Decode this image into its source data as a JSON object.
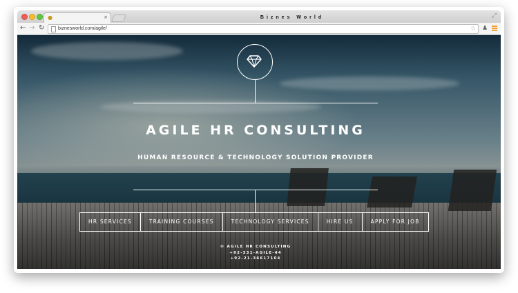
{
  "browser": {
    "tab_title": "Biznes World",
    "tab_close": "×",
    "url": "biznesworld.com/agile/",
    "back_glyph": "←",
    "forward_glyph": "→",
    "reload_glyph": "↻",
    "star_glyph": "☆",
    "extension_glyph": "♟",
    "expand_glyph": "⤢",
    "favicon_glyph": "●",
    "icons": [
      "back-icon",
      "forward-icon",
      "reload-icon",
      "page-icon",
      "star-icon",
      "extension-icon",
      "menu-icon",
      "expand-icon"
    ]
  },
  "hero": {
    "icon": "diamond-icon",
    "title": "AGILE HR CONSULTING",
    "subtitle": "HUMAN RESOURCE & TECHNOLOGY SOLUTION PROVIDER"
  },
  "nav": {
    "items": [
      {
        "label": "HR SERVICES"
      },
      {
        "label": "TRAINING COURSES"
      },
      {
        "label": "TECHNOLOGY SERVICES"
      },
      {
        "label": "HIRE US"
      },
      {
        "label": "APPLY FOR JOB"
      }
    ]
  },
  "footer": {
    "copyright": "© AGILE HR CONSULTING",
    "phone_1": "+92-331-AGILE-44",
    "phone_2": "+92-21-36617104"
  }
}
